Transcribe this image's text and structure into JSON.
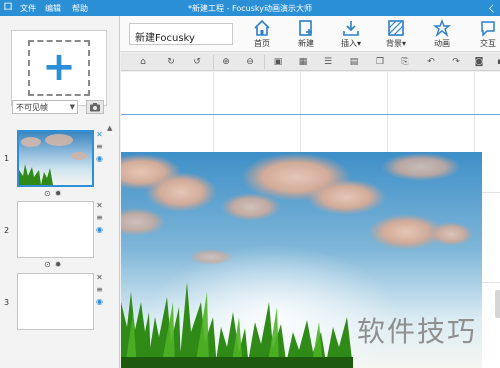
{
  "titlebar": {
    "logo_glyph": "ロ",
    "menu": [
      "文件",
      "编辑",
      "帮助"
    ],
    "title": "*新建工程 - Focusky动画演示大师",
    "window_glyphs": "ㄑ"
  },
  "ribbon": {
    "project_name": "新建Focusky",
    "buttons": [
      {
        "label": "首页",
        "icon": "home-icon"
      },
      {
        "label": "新建",
        "icon": "new-icon"
      },
      {
        "label": "插入",
        "icon": "insert-icon",
        "dropdown": "▾"
      },
      {
        "label": "背景",
        "icon": "background-icon",
        "dropdown": "▾"
      },
      {
        "label": "动画",
        "icon": "animation-icon"
      },
      {
        "label": "交互",
        "icon": "interaction-icon"
      }
    ]
  },
  "left_panel": {
    "add_glyph": "+",
    "frame_mode": "不可见帧",
    "frame_mode_arrow": "▼",
    "scroll_up_glyph": "▲",
    "slides": [
      {
        "number": "1",
        "active": true
      },
      {
        "number": "2",
        "active": false
      },
      {
        "number": "3",
        "active": false
      }
    ],
    "close_glyph": "✕",
    "menu_glyph": "≡",
    "eye_glyph": "◉",
    "play_glyph": "⊙",
    "settings_glyph": "✹"
  },
  "toolbar": {
    "icons": [
      "home-icon",
      "redo-icon",
      "undo-icon",
      "zoom-in-icon",
      "zoom-out-icon",
      "lock-icon",
      "grid-icon",
      "align-icon",
      "layers-icon",
      "copy-icon",
      "paste-icon",
      "back-icon",
      "forward-icon",
      "camera-icon",
      "snapshot-icon"
    ]
  },
  "canvas": {
    "watermark": "软件技巧"
  },
  "colors": {
    "accent": "#2e8fd8",
    "titlebar": "#2b8fd6",
    "sky_top": "#3e8fc8",
    "grass": "#2f8a17"
  }
}
